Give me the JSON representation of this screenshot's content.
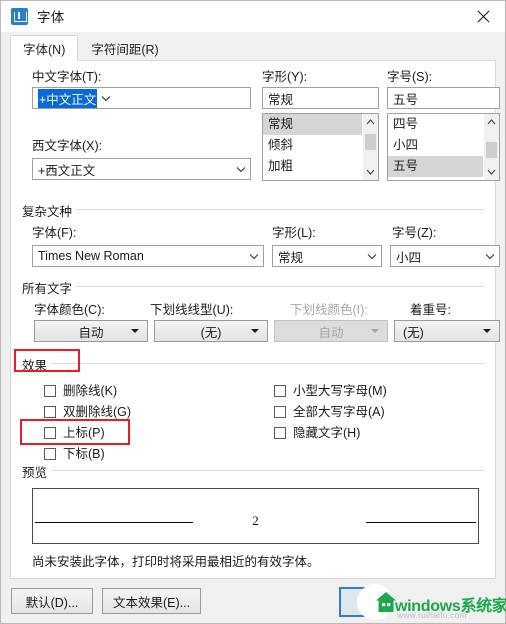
{
  "window": {
    "title": "字体",
    "icon": "wps-w-icon",
    "close_label": "✕"
  },
  "tabs": [
    {
      "label": "字体(N)",
      "active": true
    },
    {
      "label": "字符间距(R)",
      "active": false
    }
  ],
  "chinese_font": {
    "label": "中文字体(T):",
    "value": "+中文正文"
  },
  "latin_font": {
    "label": "西文字体(X):",
    "value": "+西文正文"
  },
  "font_style": {
    "label": "字形(Y):",
    "value": "常规",
    "options": [
      "常规",
      "倾斜",
      "加粗"
    ],
    "selected": "常规"
  },
  "font_size": {
    "label": "字号(S):",
    "value": "五号",
    "options": [
      "四号",
      "小四",
      "五号"
    ],
    "selected": "五号"
  },
  "complex_script": {
    "group_title": "复杂文种",
    "font": {
      "label": "字体(F):",
      "value": "Times New Roman"
    },
    "style": {
      "label": "字形(L):",
      "value": "常规"
    },
    "size": {
      "label": "字号(Z):",
      "value": "小四"
    }
  },
  "all_text": {
    "group_title": "所有文字",
    "font_color": {
      "label": "字体颜色(C):",
      "value": "自动",
      "disabled": false
    },
    "underline_style": {
      "label": "下划线线型(U):",
      "value": "(无)",
      "disabled": false
    },
    "underline_color": {
      "label": "下划线颜色(I):",
      "value": "自动",
      "disabled": true
    },
    "emphasis_mark": {
      "label": "着重号:",
      "value": "(无)",
      "disabled": false
    }
  },
  "effects": {
    "group_title": "效果",
    "left_column": [
      {
        "label": "删除线(K)",
        "checked": false
      },
      {
        "label": "双删除线(G)",
        "checked": false
      },
      {
        "label": "上标(P)",
        "checked": false
      },
      {
        "label": "下标(B)",
        "checked": false
      }
    ],
    "right_column": [
      {
        "label": "小型大写字母(M)",
        "checked": false
      },
      {
        "label": "全部大写字母(A)",
        "checked": false
      },
      {
        "label": "隐藏文字(H)",
        "checked": false
      }
    ]
  },
  "preview": {
    "group_title": "预览",
    "sample_text": "2",
    "note": "尚未安装此字体，打印时将采用最相近的有效字体。"
  },
  "footer": {
    "default_button": "默认(D)...",
    "text_effects_button": "文本效果(E)..."
  },
  "watermark": {
    "brand_latin": "windows",
    "brand_cn": "系统家园",
    "url": "www.ruihaifu.com"
  },
  "annotations": {
    "highlight_color": "#ec1c24",
    "boxes": [
      "effects-group-title",
      "superscript-checkbox"
    ]
  }
}
